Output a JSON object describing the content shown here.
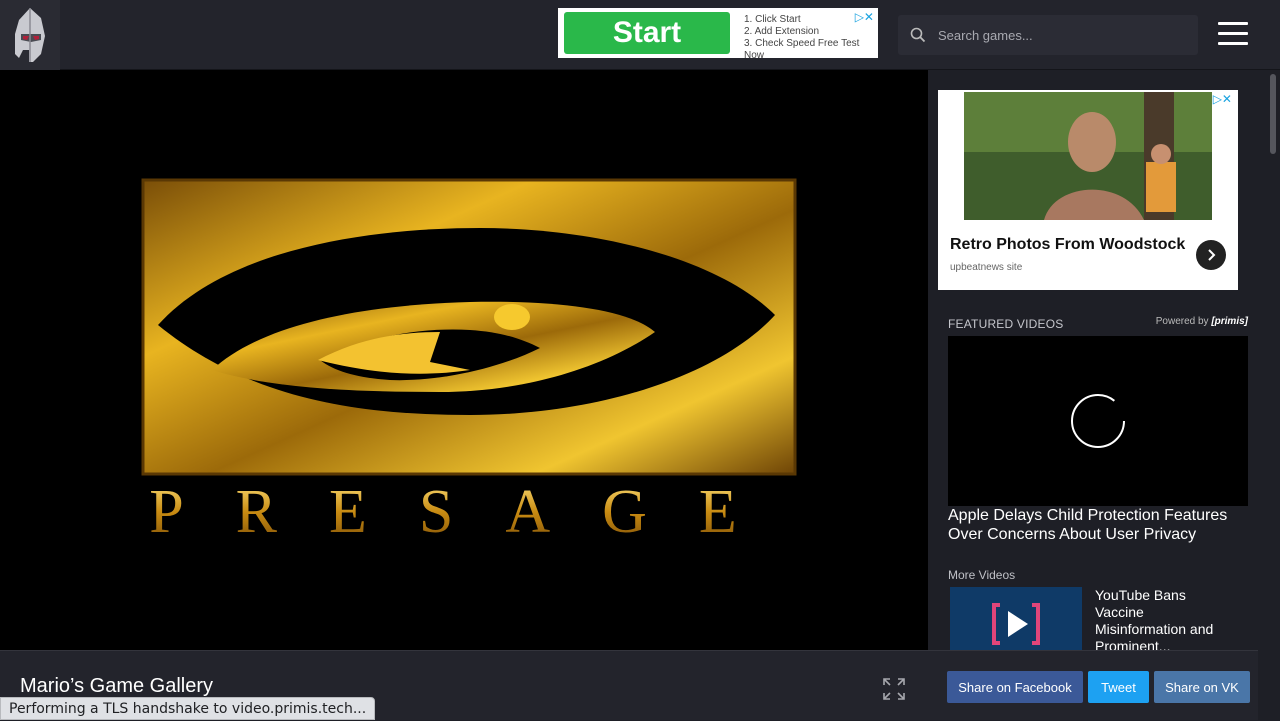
{
  "header": {
    "logo_icon": "helmet-icon",
    "search_placeholder": "Search games...",
    "menu_icon": "hamburger-menu-icon"
  },
  "top_ad": {
    "button_label": "Start",
    "steps": [
      "1. Click Start",
      "2. Add Extension",
      "3. Check Speed Free Test Now"
    ]
  },
  "game": {
    "logo_text": "PRESAGE",
    "title": "Mario’s Game Gallery",
    "fullscreen_icon": "fullscreen-icon"
  },
  "side_ad": {
    "headline": "Retro Photos From Woodstock",
    "source": "upbeatnews site"
  },
  "featured": {
    "label": "FEATURED VIDEOS",
    "powered_prefix": "Powered by",
    "powered_brand": "[primis]",
    "video_title": "Apple Delays Child Protection Features Over Concerns About User Privacy"
  },
  "more_videos": {
    "label": "More Videos",
    "items": [
      {
        "title": "YouTube Bans Vaccine Misinformation and Prominent..."
      }
    ]
  },
  "share": {
    "facebook": "Share on Facebook",
    "tweet": "Tweet",
    "vk": "Share on VK"
  },
  "status_text": "Performing a TLS handshake to video.primis.tech...",
  "colors": {
    "facebook": "#3b5998",
    "twitter": "#1da1f2",
    "vk": "#4a76a8",
    "background": "#1e1f26",
    "gold": "#d9a11a"
  }
}
